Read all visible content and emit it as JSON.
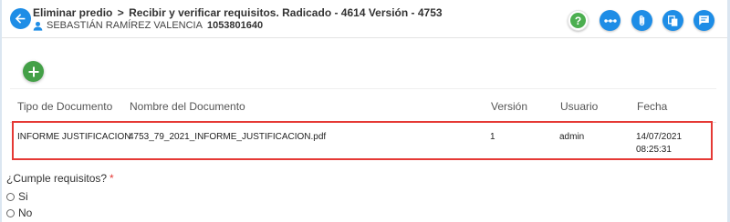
{
  "header": {
    "title_part1": "Eliminar predio",
    "title_sep": ">",
    "title_part2": "Recibir y verificar requisitos. Radicado - 4614 Versión - 4753",
    "user_name": "SEBASTIÁN RAMÍREZ VALENCIA",
    "user_id": "1053801640",
    "help_label": "?"
  },
  "table": {
    "columns": [
      "Tipo de Documento",
      "Nombre del Documento",
      "Versión",
      "Usuario",
      "Fecha"
    ],
    "rows": [
      {
        "tipo": "INFORME JUSTIFICACION",
        "nombre": "4753_79_2021_INFORME_JUSTIFICACION.pdf",
        "version": "1",
        "usuario": "admin",
        "fecha": "14/07/2021",
        "hora": "08:25:31"
      }
    ]
  },
  "form": {
    "question": "¿Cumple requisitos?",
    "required_mark": "*",
    "options": [
      "Si",
      "No"
    ]
  },
  "colors": {
    "primary": "#1e8de6",
    "add": "#43a047",
    "help": "#4caf50",
    "highlight": "#e53935"
  }
}
